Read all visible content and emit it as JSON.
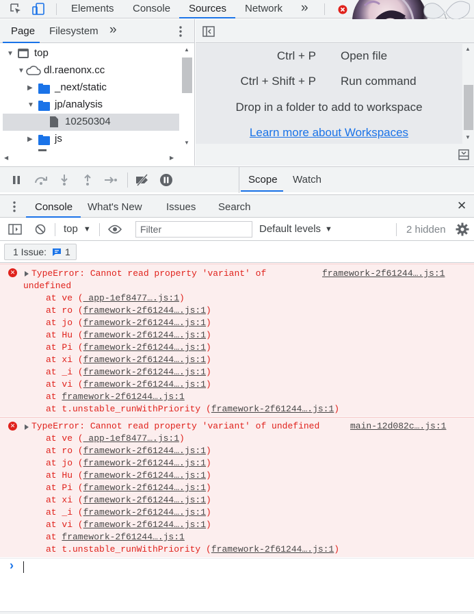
{
  "toolbar": {
    "tabs": [
      "Elements",
      "Console",
      "Sources",
      "Network"
    ],
    "active_tab": "Sources",
    "more": "»"
  },
  "navigator": {
    "tabs": [
      "Page",
      "Filesystem"
    ],
    "more": "»",
    "tree": [
      {
        "label": "top",
        "kind": "frame"
      },
      {
        "label": "dl.raenonx.cc",
        "kind": "cloud"
      },
      {
        "label": "_next/static",
        "kind": "folder"
      },
      {
        "label": "jp/analysis",
        "kind": "folder"
      },
      {
        "label": "10250304",
        "kind": "file"
      },
      {
        "label": "js",
        "kind": "folder"
      }
    ]
  },
  "editor": {
    "shortcuts": [
      {
        "key": "Ctrl + P",
        "action": "Open file"
      },
      {
        "key": "Ctrl + Shift + P",
        "action": "Run command"
      }
    ],
    "drop_text": "Drop in a folder to add to workspace",
    "learn_link": "Learn more about Workspaces"
  },
  "debugger": {
    "tabs": [
      "Scope",
      "Watch"
    ]
  },
  "drawer": {
    "tabs": [
      "Console",
      "What's New",
      "Issues",
      "Search"
    ],
    "close": "✕"
  },
  "console_toolbar": {
    "context": "top",
    "filter_placeholder": "Filter",
    "levels": "Default levels",
    "hidden": "2 hidden"
  },
  "issues_bar": {
    "label": "1 Issue:",
    "count": "1"
  },
  "errors": [
    {
      "message_line1": "TypeError: Cannot read property 'variant' of",
      "message_line2": "undefined",
      "source": "framework-2f61244….js:1",
      "stack": [
        {
          "prefix": "at ve (",
          "link": "_app-1ef8477….js:1",
          "suffix": ")"
        },
        {
          "prefix": "at ro (",
          "link": "framework-2f61244….js:1",
          "suffix": ")"
        },
        {
          "prefix": "at jo (",
          "link": "framework-2f61244….js:1",
          "suffix": ")"
        },
        {
          "prefix": "at Hu (",
          "link": "framework-2f61244….js:1",
          "suffix": ")"
        },
        {
          "prefix": "at Pi (",
          "link": "framework-2f61244….js:1",
          "suffix": ")"
        },
        {
          "prefix": "at xi (",
          "link": "framework-2f61244….js:1",
          "suffix": ")"
        },
        {
          "prefix": "at _i (",
          "link": "framework-2f61244….js:1",
          "suffix": ")"
        },
        {
          "prefix": "at vi (",
          "link": "framework-2f61244….js:1",
          "suffix": ")"
        },
        {
          "prefix": "at ",
          "link": "framework-2f61244….js:1",
          "suffix": ""
        },
        {
          "prefix": "at t.unstable_runWithPriority (",
          "link": "framework-2f61244….js:1",
          "suffix": ")"
        }
      ]
    },
    {
      "message_line1": "TypeError: Cannot read property 'variant' of undefined",
      "message_line2": "",
      "source": "main-12d082c….js:1",
      "stack": [
        {
          "prefix": "at ve (",
          "link": "_app-1ef8477….js:1",
          "suffix": ")"
        },
        {
          "prefix": "at ro (",
          "link": "framework-2f61244….js:1",
          "suffix": ")"
        },
        {
          "prefix": "at jo (",
          "link": "framework-2f61244….js:1",
          "suffix": ")"
        },
        {
          "prefix": "at Hu (",
          "link": "framework-2f61244….js:1",
          "suffix": ")"
        },
        {
          "prefix": "at Pi (",
          "link": "framework-2f61244….js:1",
          "suffix": ")"
        },
        {
          "prefix": "at xi (",
          "link": "framework-2f61244….js:1",
          "suffix": ")"
        },
        {
          "prefix": "at _i (",
          "link": "framework-2f61244….js:1",
          "suffix": ")"
        },
        {
          "prefix": "at vi (",
          "link": "framework-2f61244….js:1",
          "suffix": ")"
        },
        {
          "prefix": "at ",
          "link": "framework-2f61244….js:1",
          "suffix": ""
        },
        {
          "prefix": "at t.unstable_runWithPriority (",
          "link": "framework-2f61244….js:1",
          "suffix": ")"
        }
      ]
    }
  ],
  "prompt": "›",
  "colors": {
    "accent": "#1a73e8",
    "error": "#e0221c",
    "error_bg": "#fceeee"
  }
}
